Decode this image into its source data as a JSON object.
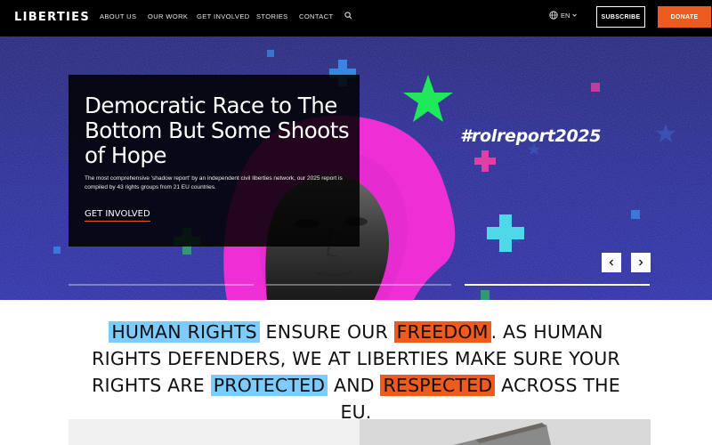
{
  "brand": {
    "name": "LIBERTIES",
    "accent_color": "#ef5a1e",
    "highlight_blue": "#7ecbff"
  },
  "nav": {
    "links": [
      "ABOUT US",
      "OUR WORK",
      "GET INVOLVED",
      "STORIES",
      "CONTACT"
    ],
    "language": "EN",
    "subscribe_label": "SUBSCRIBE",
    "donate_label": "DONATE",
    "icons": [
      "search-icon",
      "globe-icon",
      "chevron-down-icon"
    ]
  },
  "hero": {
    "title": "Democratic Race to The Bottom But Some Shoots of Hope",
    "text": "The most comprehensive 'shadow report' by an independent civil liberties network, our 2025 report is compiled by 43 rights groups from 21 EU countries.",
    "cta_label": "GET INVOLVED",
    "hashtag": "#rolreport2025",
    "slides_total": 3,
    "active_slide": 3,
    "controls": [
      "chevron-left-icon",
      "chevron-right-icon"
    ]
  },
  "statement": {
    "parts": [
      {
        "text": "HUMAN RIGHTS",
        "highlight": "blue"
      },
      {
        "text": " ENSURE OUR ",
        "highlight": ""
      },
      {
        "text": "FREEDOM",
        "highlight": "orange"
      },
      {
        "text": ". AS HUMAN RIGHTS DEFENDERS, WE AT LIBERTIES MAKE SURE YOUR RIGHTS ARE ",
        "highlight": ""
      },
      {
        "text": "PROTECTED",
        "highlight": "blue"
      },
      {
        "text": " AND ",
        "highlight": ""
      },
      {
        "text": "RESPECTED",
        "highlight": "orange"
      },
      {
        "text": " ACROSS THE EU.",
        "highlight": ""
      }
    ]
  }
}
